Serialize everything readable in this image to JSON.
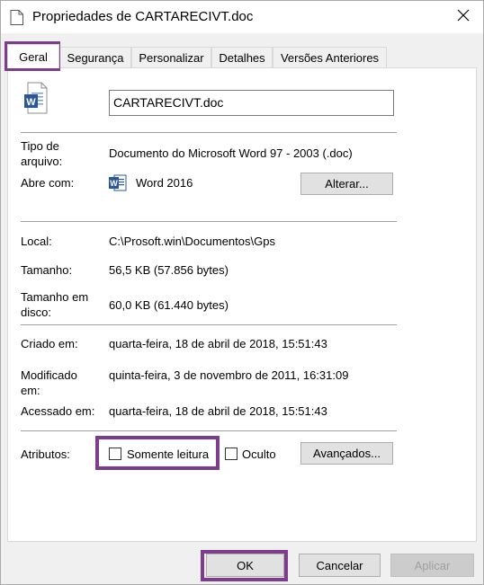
{
  "window": {
    "title": "Propriedades de CARTARECIVT.doc",
    "close_icon": "close-icon"
  },
  "tabs": [
    {
      "label": "Geral",
      "active": true
    },
    {
      "label": "Segurança",
      "active": false
    },
    {
      "label": "Personalizar",
      "active": false
    },
    {
      "label": "Detalhes",
      "active": false
    },
    {
      "label": "Versões Anteriores",
      "active": false
    }
  ],
  "general": {
    "file_icon": "word-doc-icon",
    "file_name": "CARTARECIVT.doc",
    "type_label": "Tipo de arquivo:",
    "type_value": "Documento do Microsoft Word 97 - 2003 (.doc)",
    "opens_with_label": "Abre com:",
    "opens_with_icon": "word-app-icon",
    "opens_with_value": "Word 2016",
    "change_button": "Alterar...",
    "location_label": "Local:",
    "location_value": "C:\\Prosoft.win\\Documentos\\Gps",
    "size_label": "Tamanho:",
    "size_value": "56,5 KB (57.856 bytes)",
    "size_on_disk_label": "Tamanho em disco:",
    "size_on_disk_value": "60,0 KB (61.440 bytes)",
    "created_label": "Criado em:",
    "created_value": "quarta-feira, 18 de abril de 2018, 15:51:43",
    "modified_label": "Modificado em:",
    "modified_value": "quinta-feira, 3 de novembro de 2011, 16:31:09",
    "accessed_label": "Acessado em:",
    "accessed_value": "quarta-feira, 18 de abril de 2018, 15:51:43",
    "attributes_label": "Atributos:",
    "readonly_label": "Somente leitura",
    "readonly_checked": false,
    "hidden_label": "Oculto",
    "hidden_checked": false,
    "advanced_button": "Avançados..."
  },
  "footer": {
    "ok_button": "OK",
    "cancel_button": "Cancelar",
    "apply_button": "Aplicar"
  },
  "colors": {
    "highlight": "#7e3c8c",
    "word_blue": "#2b579a"
  }
}
